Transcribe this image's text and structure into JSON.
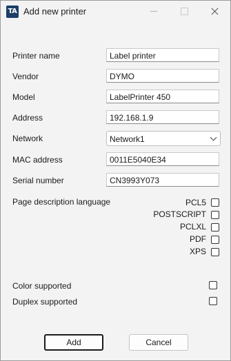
{
  "window": {
    "title": "Add new printer",
    "icon_text": "TA"
  },
  "fields": [
    {
      "label": "Printer name",
      "value": "Label printer"
    },
    {
      "label": "Vendor",
      "value": "DYMO"
    },
    {
      "label": "Model",
      "value": "LabelPrinter 450"
    },
    {
      "label": "Address",
      "value": "192.168.1.9"
    }
  ],
  "network": {
    "label": "Network",
    "selected": "Network1"
  },
  "mac": {
    "label": "MAC address",
    "value": "0011E5040E34"
  },
  "serial": {
    "label": "Serial number",
    "value": "CN3993Y073"
  },
  "pdl": {
    "label": "Page description language",
    "options": [
      {
        "label": "PCL5",
        "checked": false
      },
      {
        "label": "POSTSCRIPT",
        "checked": false
      },
      {
        "label": "PCLXL",
        "checked": false
      },
      {
        "label": "PDF",
        "checked": false
      },
      {
        "label": "XPS",
        "checked": false
      }
    ]
  },
  "color_supported": {
    "label": "Color supported",
    "checked": false
  },
  "duplex_supported": {
    "label": "Duplex supported",
    "checked": false
  },
  "buttons": {
    "add": "Add",
    "cancel": "Cancel"
  }
}
